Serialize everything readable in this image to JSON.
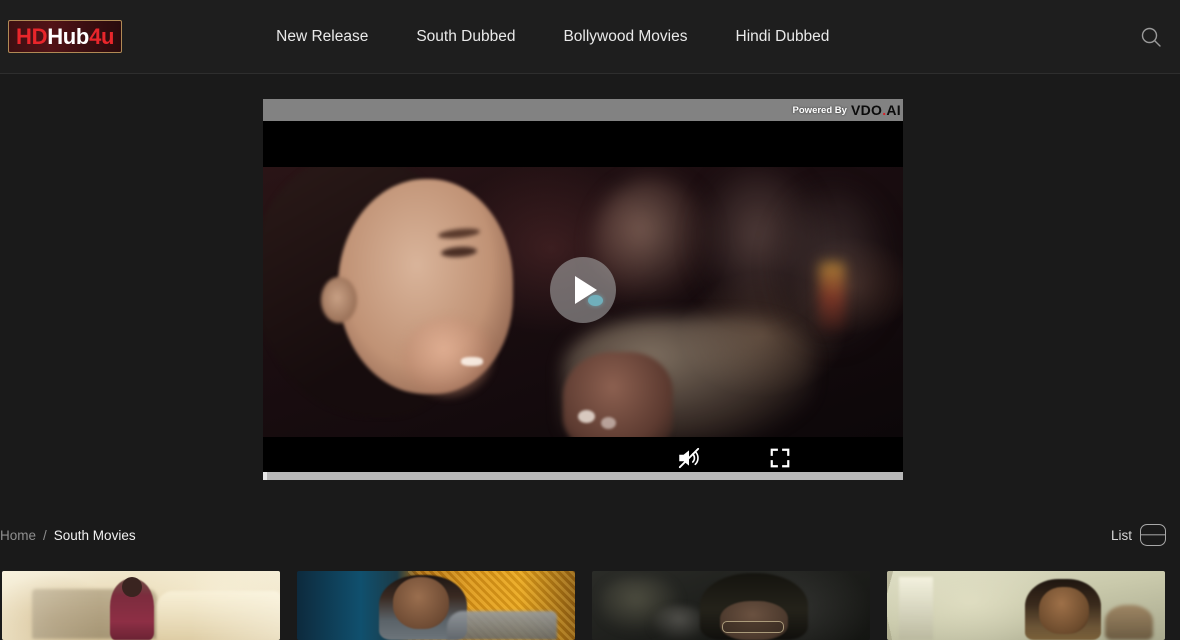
{
  "site": {
    "logo": {
      "part1": "HD",
      "part2": "Hub",
      "part3": "4u",
      "accent_color": "#e8262b"
    }
  },
  "header": {
    "nav_items": [
      {
        "label": "New Release"
      },
      {
        "label": "South Dubbed"
      },
      {
        "label": "Bollywood Movies"
      },
      {
        "label": "Hindi Dubbed"
      }
    ],
    "search_icon": "search-icon"
  },
  "player": {
    "powered_by_label": "Powered By",
    "brand_name": "VDO",
    "brand_dot": ".",
    "brand_suffix": "AI",
    "play_icon": "play-icon",
    "mute_icon": "volume-muted-icon",
    "fullscreen_icon": "fullscreen-icon",
    "progress_percent": 1,
    "topbar_color": "#828282"
  },
  "breadcrumb": {
    "home_label": "Home",
    "separator": "/",
    "current_label": "South Movies"
  },
  "view_toggle": {
    "label": "List",
    "icon": "list-view-icon"
  },
  "thumbnails": [
    {
      "scene": "man in maroon shirt beside vehicle in desert"
    },
    {
      "scene": "mustached man against blue and gold wall"
    },
    {
      "scene": "person with glasses in dark interior"
    },
    {
      "scene": "bearded man in sepia toned crowd"
    }
  ]
}
